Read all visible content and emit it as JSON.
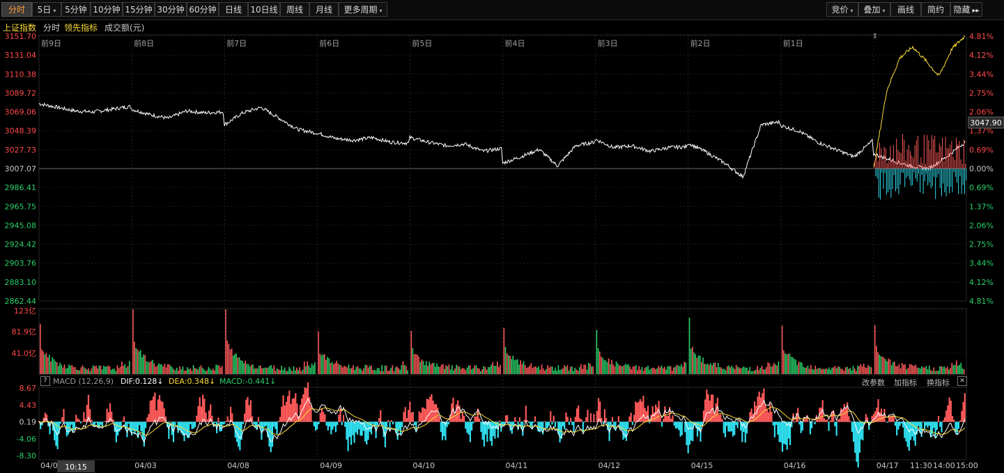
{
  "toolbar": {
    "left": [
      {
        "label": "分时",
        "active": true
      },
      {
        "label": "5日",
        "dropdown": true
      },
      {
        "label": "5分钟"
      },
      {
        "label": "10分钟"
      },
      {
        "label": "15分钟"
      },
      {
        "label": "30分钟"
      },
      {
        "label": "60分钟"
      },
      {
        "label": "日线"
      },
      {
        "label": "10日线"
      },
      {
        "label": "周线"
      },
      {
        "label": "月线"
      },
      {
        "label": "更多周期",
        "dropdown": true
      }
    ],
    "right": [
      {
        "label": "竞价",
        "dropdown": true
      },
      {
        "label": "叠加",
        "dropdown": true
      },
      {
        "label": "画线"
      },
      {
        "label": "简约"
      },
      {
        "label": "隐藏",
        "arrows": "▸▸"
      }
    ]
  },
  "info": {
    "index_name": "上证指数",
    "mode": "分时",
    "leading_indicator": "领先指标",
    "volume_label": "成交额(元)"
  },
  "price_axis": {
    "left": [
      "3151.70",
      "3131.04",
      "3110.38",
      "3089.72",
      "3069.06",
      "3048.39",
      "3027.73",
      "3007.07",
      "2986.41",
      "2965.75",
      "2945.08",
      "2924.42",
      "2903.76",
      "2883.10",
      "2862.44"
    ],
    "right": [
      "4.81%",
      "4.12%",
      "3.44%",
      "2.75%",
      "2.06%",
      "1.37%",
      "0.69%",
      "0.00%",
      "0.69%",
      "1.37%",
      "2.06%",
      "2.75%",
      "3.44%",
      "4.12%",
      "4.81%"
    ],
    "current_price": "3047.90"
  },
  "day_labels": [
    "前9日",
    "前8日",
    "前7日",
    "前6日",
    "前5日",
    "前4日",
    "前3日",
    "前2日",
    "前1日"
  ],
  "volume_axis": [
    "123亿",
    "81.9亿",
    "41.0亿"
  ],
  "macd": {
    "help": "?",
    "name": "MACD (12,26,9)",
    "dif": "DIF:0.128↓",
    "dea": "DEA:0.348↓",
    "macd": "MACD:-0.441↓",
    "actions": [
      "改参数",
      "加指标",
      "换指标"
    ],
    "close": "✕",
    "axis": [
      "8.67",
      "4.43",
      "0.19",
      "-4.06",
      "-8.30"
    ]
  },
  "time_axis": {
    "first": "04/0",
    "cursor": "10:15",
    "dates": [
      "04/03",
      "04/08",
      "04/09",
      "04/10",
      "04/11",
      "04/12",
      "04/15",
      "04/16",
      "04/17"
    ],
    "end_times": [
      "11:30",
      "14:00",
      "15:00"
    ]
  },
  "chart_data": {
    "type": "line",
    "title": "上证指数 分时",
    "days": [
      "04/03",
      "04/08",
      "04/09",
      "04/10",
      "04/11",
      "04/12",
      "04/15",
      "04/16",
      "04/17"
    ],
    "prev_close": 3007.07,
    "ylim": [
      2862.44,
      3151.7
    ],
    "series": [
      {
        "name": "上证指数",
        "day_points": [
          [
            3078,
            3074,
            3070,
            3069,
            3072,
            3075
          ],
          [
            3072,
            3066,
            3062,
            3070,
            3068,
            3069
          ],
          [
            3055,
            3068,
            3074,
            3062,
            3050,
            3046
          ],
          [
            3046,
            3040,
            3038,
            3041,
            3036,
            3035
          ],
          [
            3041,
            3036,
            3032,
            3034,
            3026,
            3029
          ],
          [
            3013,
            3020,
            3028,
            3010,
            3032,
            3036
          ],
          [
            3039,
            3030,
            3032,
            3026,
            3030,
            3031
          ],
          [
            3035,
            3025,
            3013,
            2998,
            3055,
            3058
          ],
          [
            3054,
            3048,
            3036,
            3028,
            3020,
            3037
          ],
          [
            3023,
            3016,
            3010,
            3007,
            3020,
            3036
          ]
        ]
      },
      {
        "name": "领先指标",
        "today_points": [
          3007,
          3092,
          3128,
          3140,
          3125,
          3108,
          3138,
          3152
        ]
      }
    ],
    "volume_peaks": [
      95,
      123,
      123,
      81,
      82,
      88,
      84,
      107,
      92,
      93
    ]
  }
}
